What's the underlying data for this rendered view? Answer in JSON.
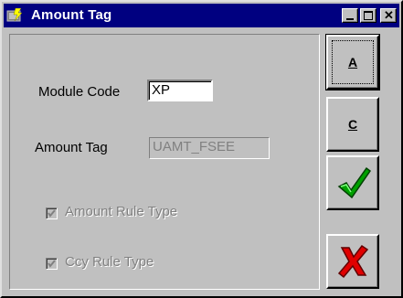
{
  "window": {
    "title": "Amount Tag"
  },
  "titlebar_buttons": {
    "minimize": "minimize-icon",
    "maximize": "maximize-icon",
    "close": "close-icon"
  },
  "form": {
    "module_code_label": "Module Code",
    "module_code_value": "XP",
    "amount_tag_label": "Amount Tag",
    "amount_tag_value": "UAMT_FSEE",
    "amount_rule_type_label": "Amount Rule Type",
    "amount_rule_type_checked": true,
    "ccy_rule_type_label": "Ccy Rule Type",
    "ccy_rule_type_checked": true
  },
  "buttons": {
    "a_label": "A",
    "c_label": "C",
    "ok_icon": "green-checkmark-icon",
    "cancel_icon": "red-x-icon"
  },
  "colors": {
    "title_bar": "#000080",
    "face": "#c0c0c0",
    "ok_green": "#00a000",
    "cancel_red": "#e00000"
  }
}
